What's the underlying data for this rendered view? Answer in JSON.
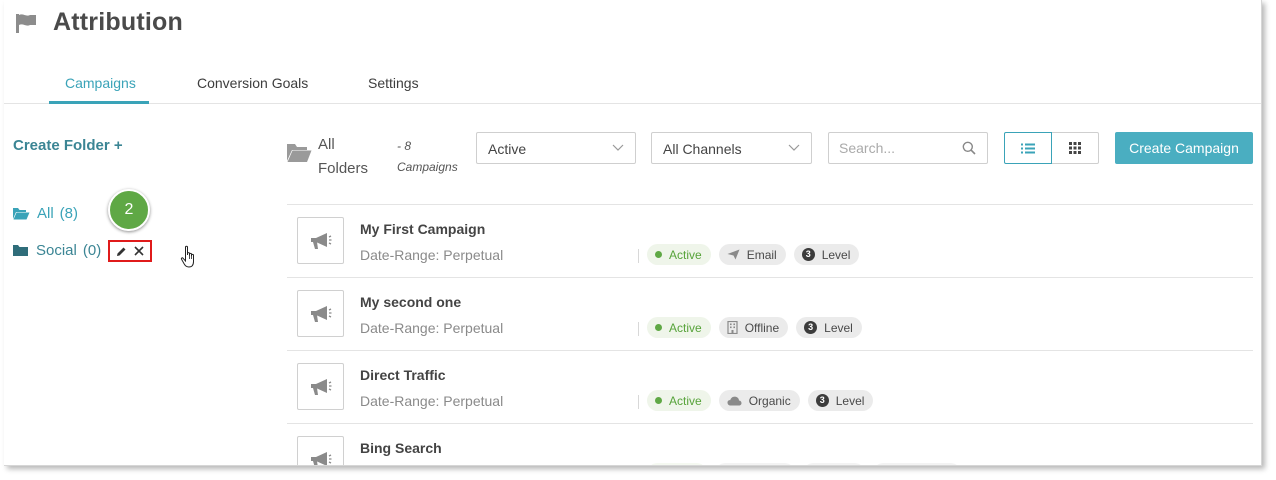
{
  "header": {
    "title": "Attribution",
    "icon": "flag-icon"
  },
  "tabs": [
    {
      "label": "Campaigns",
      "active": true
    },
    {
      "label": "Conversion Goals",
      "active": false
    },
    {
      "label": "Settings",
      "active": false
    }
  ],
  "sidebar": {
    "create_folder_label": "Create Folder +",
    "folders": [
      {
        "label": "All",
        "count": "(8)",
        "icon": "folder-open-icon"
      },
      {
        "label": "Social",
        "count": "(0)",
        "icon": "folder-icon"
      }
    ],
    "step_badge": "2"
  },
  "toolbar": {
    "breadcrumb_folder": "All Folders",
    "breadcrumb_count": "- 8 Campaigns",
    "status_filter": "Active",
    "channel_filter": "All Channels",
    "search_placeholder": "Search...",
    "create_button": "Create Campaign"
  },
  "campaigns": [
    {
      "name": "My First Campaign",
      "date_range": "Date-Range: Perpetual",
      "status": "Active",
      "channel": "Email",
      "channel_icon": "send-icon",
      "level_number": "3",
      "level_label": "Level"
    },
    {
      "name": "My second one",
      "date_range": "Date-Range: Perpetual",
      "status": "Active",
      "channel": "Offline",
      "channel_icon": "building-icon",
      "level_number": "3",
      "level_label": "Level"
    },
    {
      "name": "Direct Traffic",
      "date_range": "Date-Range: Perpetual",
      "status": "Active",
      "channel": "Organic",
      "channel_icon": "cloud-icon",
      "level_number": "3",
      "level_label": "Level"
    },
    {
      "name": "Bing Search"
    }
  ],
  "colors": {
    "accent": "#3aa3b8",
    "primary_button": "#4aaec1",
    "active_status": "#57a33a",
    "highlight_box": "#e01b1b",
    "step_badge": "#5fa845"
  }
}
